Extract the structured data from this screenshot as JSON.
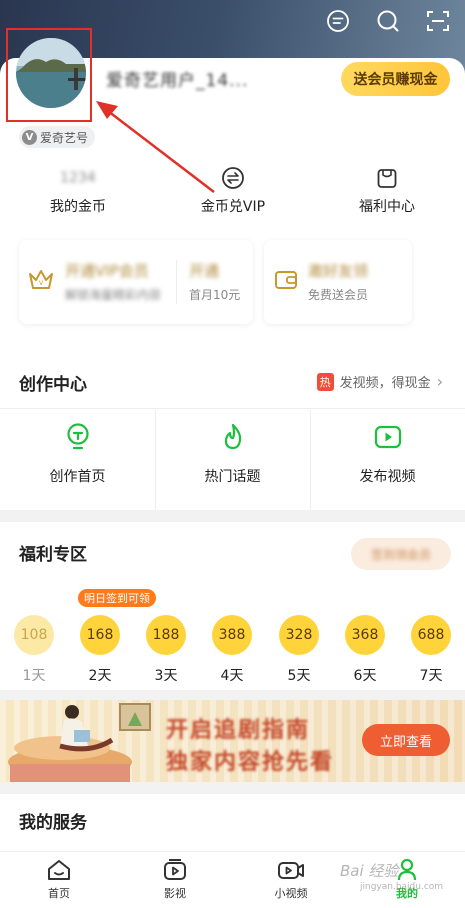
{
  "header": {
    "username": "爱奇艺用户_14...",
    "vip_button": "送会员赚现金",
    "badge": "爱奇艺号"
  },
  "quick_actions": [
    {
      "value": "1234",
      "label": "我的金币"
    },
    {
      "label": "金币兑VIP"
    },
    {
      "label": "福利中心"
    }
  ],
  "vip_cards": {
    "left_title": "开通VIP会员",
    "left_sub": "解锁海量精彩内容",
    "left_mid_title": "开通",
    "left_mid_sub": "首月10元",
    "right_title": "邀好友领",
    "right_sub": "免费送会员"
  },
  "creation_center": {
    "title": "创作中心",
    "hot_tag": "热",
    "promo": "发视频，得现金",
    "items": [
      {
        "label": "创作首页"
      },
      {
        "label": "热门话题"
      },
      {
        "label": "发布视频"
      }
    ]
  },
  "benefits": {
    "title": "福利专区",
    "pill": "签到领会员",
    "tip": "明日签到可领",
    "days": [
      {
        "coins": "108",
        "day": "1天"
      },
      {
        "coins": "168",
        "day": "2天"
      },
      {
        "coins": "188",
        "day": "3天"
      },
      {
        "coins": "388",
        "day": "4天"
      },
      {
        "coins": "328",
        "day": "5天"
      },
      {
        "coins": "368",
        "day": "6天"
      },
      {
        "coins": "688",
        "day": "7天"
      }
    ]
  },
  "banner": {
    "line1": "开启追剧指南",
    "line2": "独家内容抢先看",
    "button": "立即查看"
  },
  "services": {
    "title": "我的服务"
  },
  "nav": [
    {
      "label": "首页"
    },
    {
      "label": "影视"
    },
    {
      "label": "小视频"
    },
    {
      "label": "我的"
    }
  ],
  "watermark": {
    "main": "Bai 经验",
    "sub": "jingyan.baidu.com"
  },
  "colors": {
    "accent": "#1fbf3e",
    "vip_gold": "#ffc53a",
    "highlight_red": "#e0302a"
  }
}
